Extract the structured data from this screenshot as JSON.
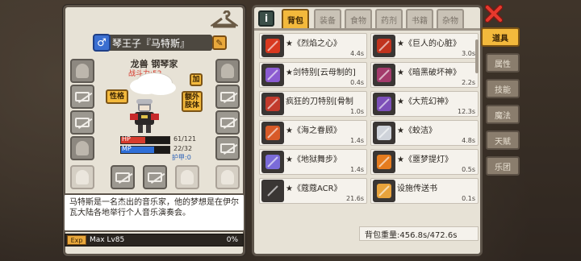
{
  "character": {
    "name": "琴王子『马特斯』",
    "gender_symbol": "♂",
    "race_class": "龙兽  钢琴家",
    "power_label": "战斗力:52",
    "btn_add": "加",
    "btn_trait": "性格",
    "btn_limbs": "额外\n肢体",
    "hp": {
      "label": "HP",
      "value": "61/121",
      "current": 61,
      "max": 121,
      "color": "#d63b2d"
    },
    "mp": {
      "label": "MP",
      "value": "22/32",
      "current": 22,
      "max": 32,
      "color": "#2f6fd8"
    },
    "armor": "护甲:0",
    "description": "马特斯是一名杰出的音乐家，他的梦想是在伊尔瓦大陆各地举行个人音乐演奏会。",
    "exp": {
      "badge": "Exp",
      "level": "Max Lv85",
      "percent": "0%"
    }
  },
  "inventory": {
    "info_symbol": "i",
    "tabs": [
      "背包",
      "装备",
      "食物",
      "药剂",
      "书籍",
      "杂物"
    ],
    "active_tab": 0,
    "items": [
      {
        "name": "★《烈焰之心》",
        "weight": "4.4s",
        "icon": "flame-armor-icon",
        "color": "#d8381f"
      },
      {
        "name": "★《巨人的心脏》",
        "weight": "3.0s",
        "icon": "giant-heart-armor-icon",
        "color": "#c0331e"
      },
      {
        "name": "★剑特别[云母制的]",
        "weight": "0.4s",
        "icon": "purple-dagger-icon",
        "color": "#8b5bd1"
      },
      {
        "name": "★《暗黑破坏神》",
        "weight": "2.2s",
        "icon": "dark-sword-icon",
        "color": "#a33a6b"
      },
      {
        "name": "疯狂的刀特别[骨制",
        "weight": "1.0s",
        "icon": "bone-knife-icon",
        "color": "#c23a2c"
      },
      {
        "name": "★《大荒幻神》",
        "weight": "12.3s",
        "icon": "scythe-icon",
        "color": "#7c4fb8"
      },
      {
        "name": "★《海之眷顾》",
        "weight": "1.4s",
        "icon": "sea-sword-icon",
        "color": "#d85a28"
      },
      {
        "name": "★《蛟洁》",
        "weight": "4.8s",
        "icon": "gauntlet-icon",
        "color": "#cfd3da"
      },
      {
        "name": "★《地狱舞步》",
        "weight": "1.4s",
        "icon": "hell-boots-icon",
        "color": "#7a6bd8"
      },
      {
        "name": "★《噩梦提灯》",
        "weight": "0.5s",
        "icon": "pumpkin-lantern-icon",
        "color": "#e57b1e"
      },
      {
        "name": "★《蔻蔻ACR》",
        "weight": "21.6s",
        "icon": "rifle-icon",
        "color": "#3a3634"
      },
      {
        "name": "设施传送书",
        "weight": "0.1s",
        "icon": "teleport-book-icon",
        "color": "#e8a33c"
      }
    ],
    "weight_label": "背包重量:456.8s/472.6s"
  },
  "menu": {
    "items": [
      "道具",
      "属性",
      "技能",
      "魔法",
      "天赋",
      "乐团"
    ],
    "active": 0
  }
}
